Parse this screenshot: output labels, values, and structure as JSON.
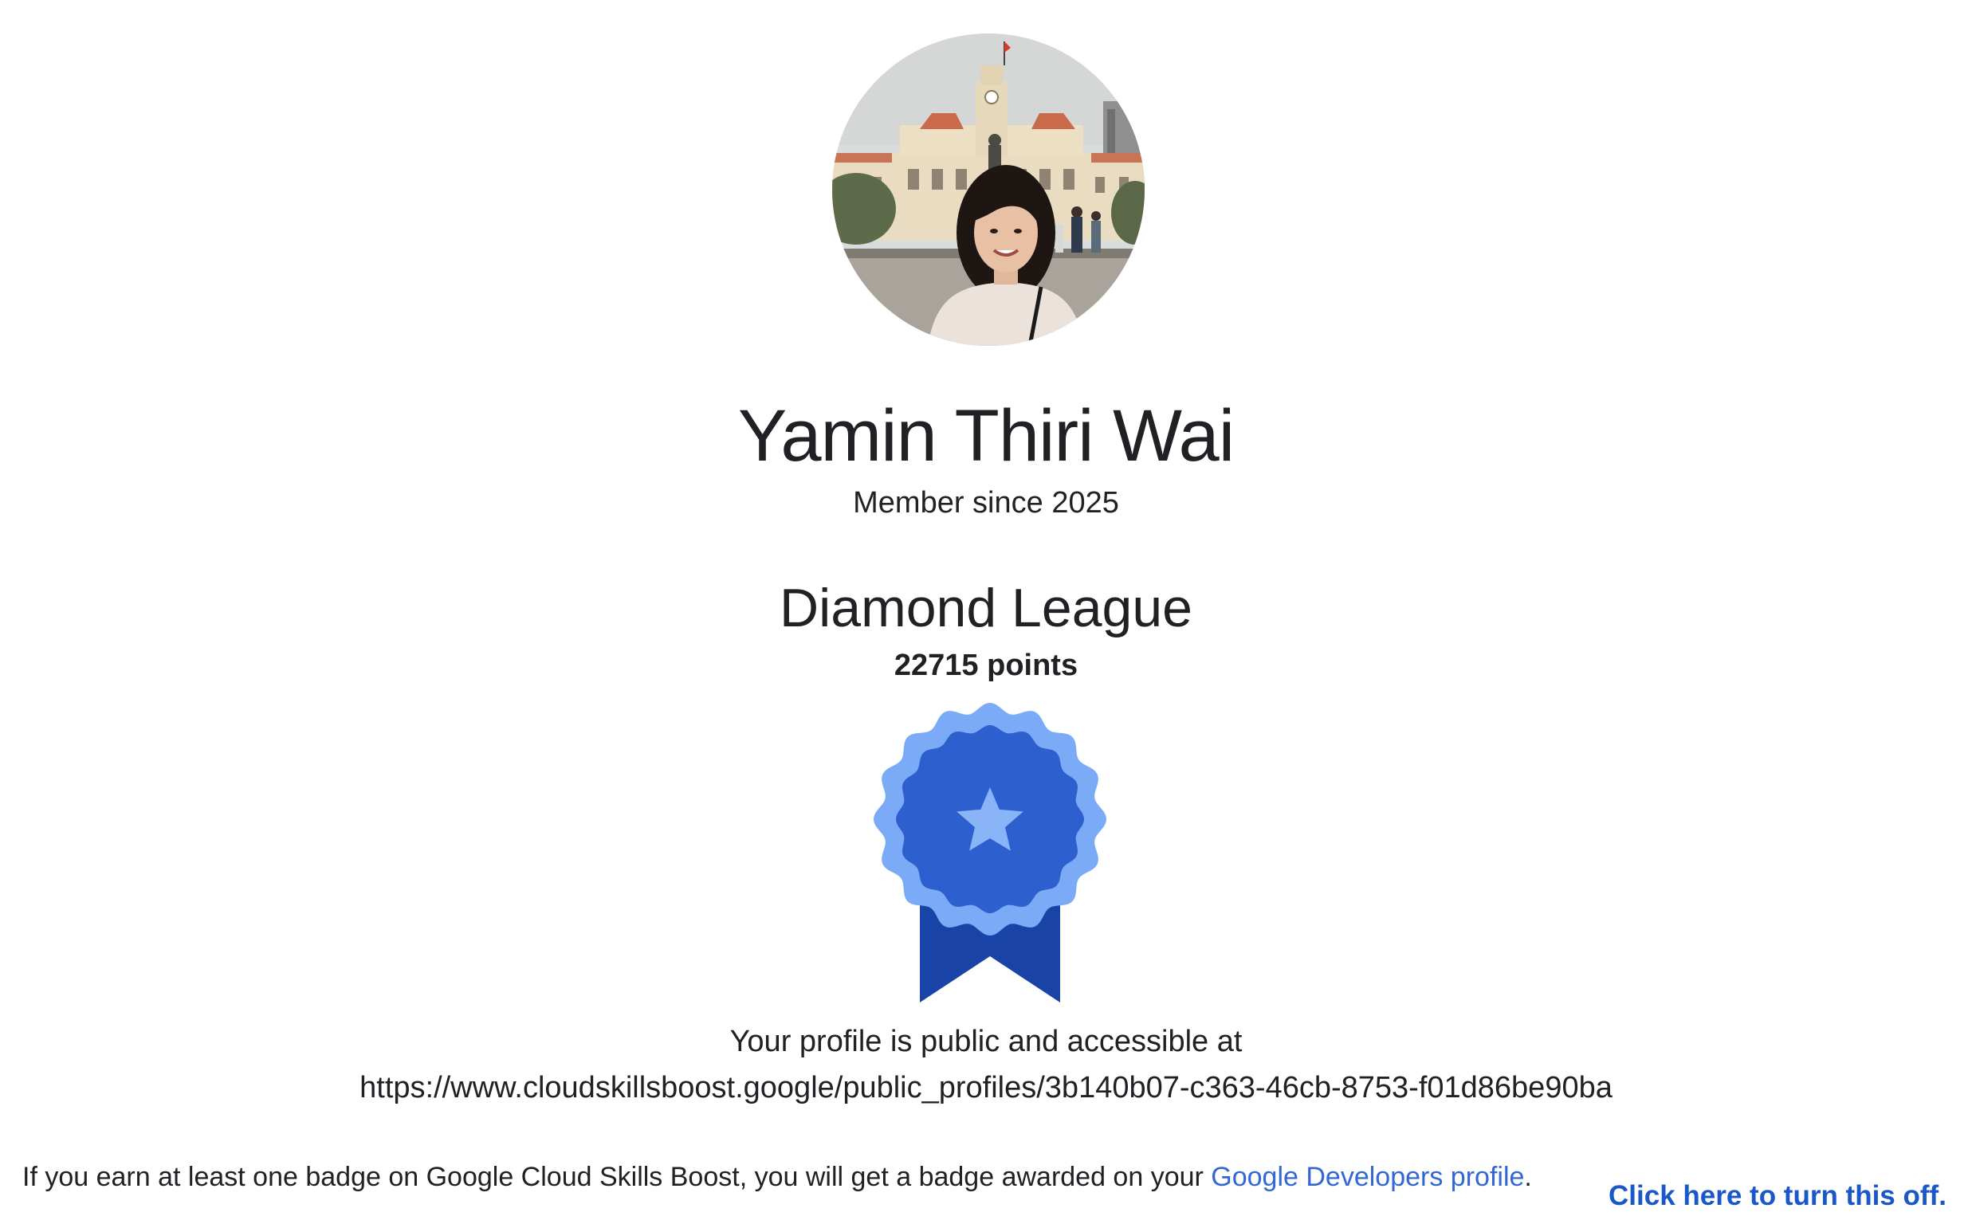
{
  "profile": {
    "name": "Yamin Thiri Wai",
    "member_since": "Member since 2025",
    "avatar_icon": "profile-photo",
    "league": "Diamond League",
    "points": "22715 points",
    "badge_icon": "diamond-league-ribbon-icon",
    "badge_colors": {
      "outer": "#7baaf7",
      "inner": "#2d5fcf",
      "star": "#8ab4f8",
      "ribbon": "#1a43a8"
    }
  },
  "visibility": {
    "public_text": "Your profile is public and accessible at",
    "public_url": "https://www.cloudskillsboost.google/public_profiles/3b140b07-c363-46cb-8753-f01d86be90ba"
  },
  "footer": {
    "notice_text": "If you earn at least one badge on Google Cloud Skills Boost, you will get a badge awarded on your ",
    "developers_link": "Google Developers profile",
    "period": ".",
    "turn_off_link": "Click here to turn this off."
  },
  "colors": {
    "link": "#3367d6",
    "text": "#202124"
  }
}
